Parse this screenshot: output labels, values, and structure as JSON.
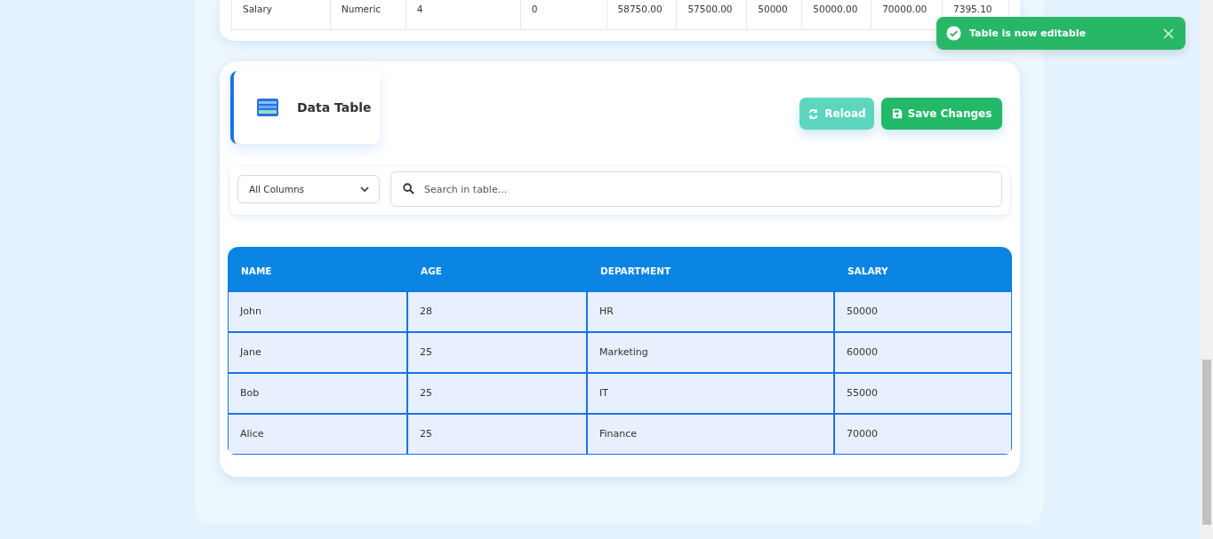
{
  "summary_table": {
    "rows": [
      [
        "Salary",
        "Numeric",
        "4",
        "0",
        "58750.00",
        "57500.00",
        "50000",
        "50000.00",
        "70000.00",
        "7395.10"
      ]
    ]
  },
  "data_table": {
    "title": "Data Table",
    "buttons": [
      {
        "kind": "reload",
        "label": "Reload"
      },
      {
        "kind": "save",
        "label": "Save Changes"
      }
    ],
    "column_filter": {
      "value": "All Columns"
    },
    "search": {
      "placeholder": "Search in table..."
    },
    "columns": [
      "NAME",
      "AGE",
      "DEPARTMENT",
      "SALARY"
    ],
    "rows": [
      [
        "John",
        "28",
        "HR",
        "50000"
      ],
      [
        "Jane",
        "25",
        "Marketing",
        "60000"
      ],
      [
        "Bob",
        "25",
        "IT",
        "55000"
      ],
      [
        "Alice",
        "25",
        "Finance",
        "70000"
      ]
    ]
  },
  "toast": {
    "message": "Table is now editable"
  }
}
